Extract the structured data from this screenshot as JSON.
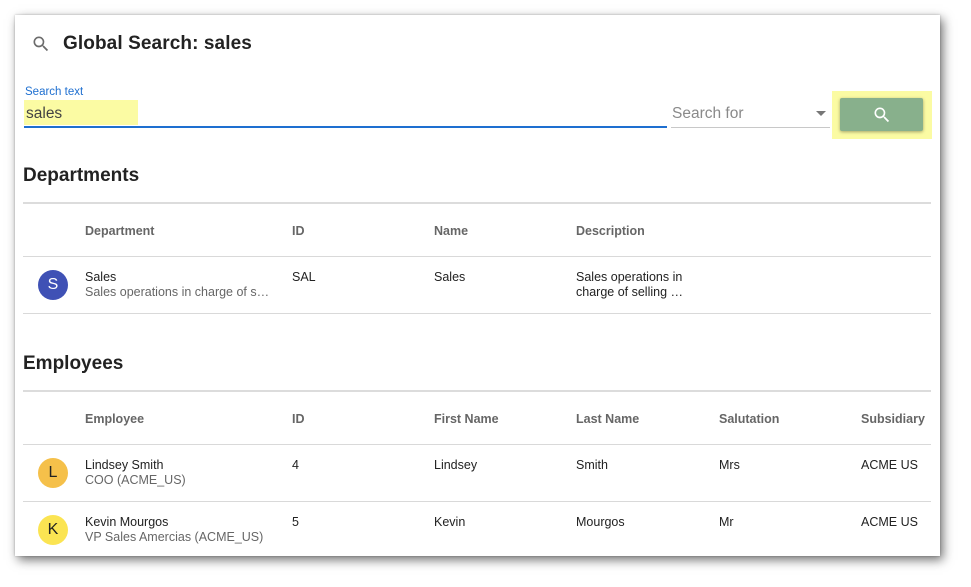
{
  "header": {
    "title": "Global Search: sales"
  },
  "search": {
    "label": "Search text",
    "value": "sales",
    "search_for_placeholder": "Search for"
  },
  "departments": {
    "title": "Departments",
    "columns": [
      "Department",
      "ID",
      "Name",
      "Description"
    ],
    "rows": [
      {
        "avatar": "S",
        "avatar_color": "#3f51b5",
        "primary": "Sales",
        "secondary": "Sales operations in charge of s…",
        "id": "SAL",
        "name": "Sales",
        "description_line1": "Sales operations in",
        "description_line2": "charge of selling …"
      }
    ]
  },
  "employees": {
    "title": "Employees",
    "columns": [
      "Employee",
      "ID",
      "First Name",
      "Last Name",
      "Salutation",
      "Subsidiary"
    ],
    "rows": [
      {
        "avatar": "L",
        "avatar_color": "#f5c04a",
        "primary": "Lindsey Smith",
        "secondary": "COO (ACME_US)",
        "id": "4",
        "first_name": "Lindsey",
        "last_name": "Smith",
        "salutation": "Mrs",
        "subsidiary": "ACME US"
      },
      {
        "avatar": "K",
        "avatar_color": "#fbe452",
        "primary": "Kevin Mourgos",
        "secondary": "VP Sales Amercias (ACME_US)",
        "id": "5",
        "first_name": "Kevin",
        "last_name": "Mourgos",
        "salutation": "Mr",
        "subsidiary": "ACME US"
      }
    ]
  },
  "colors": {
    "accent": "#1e6fd0",
    "search_button": "#88b08c",
    "highlight": "#fbfba3"
  },
  "icons": {
    "title_icon": "search-icon",
    "button_icon": "search-icon",
    "dropdown_icon": "caret-down-icon"
  }
}
